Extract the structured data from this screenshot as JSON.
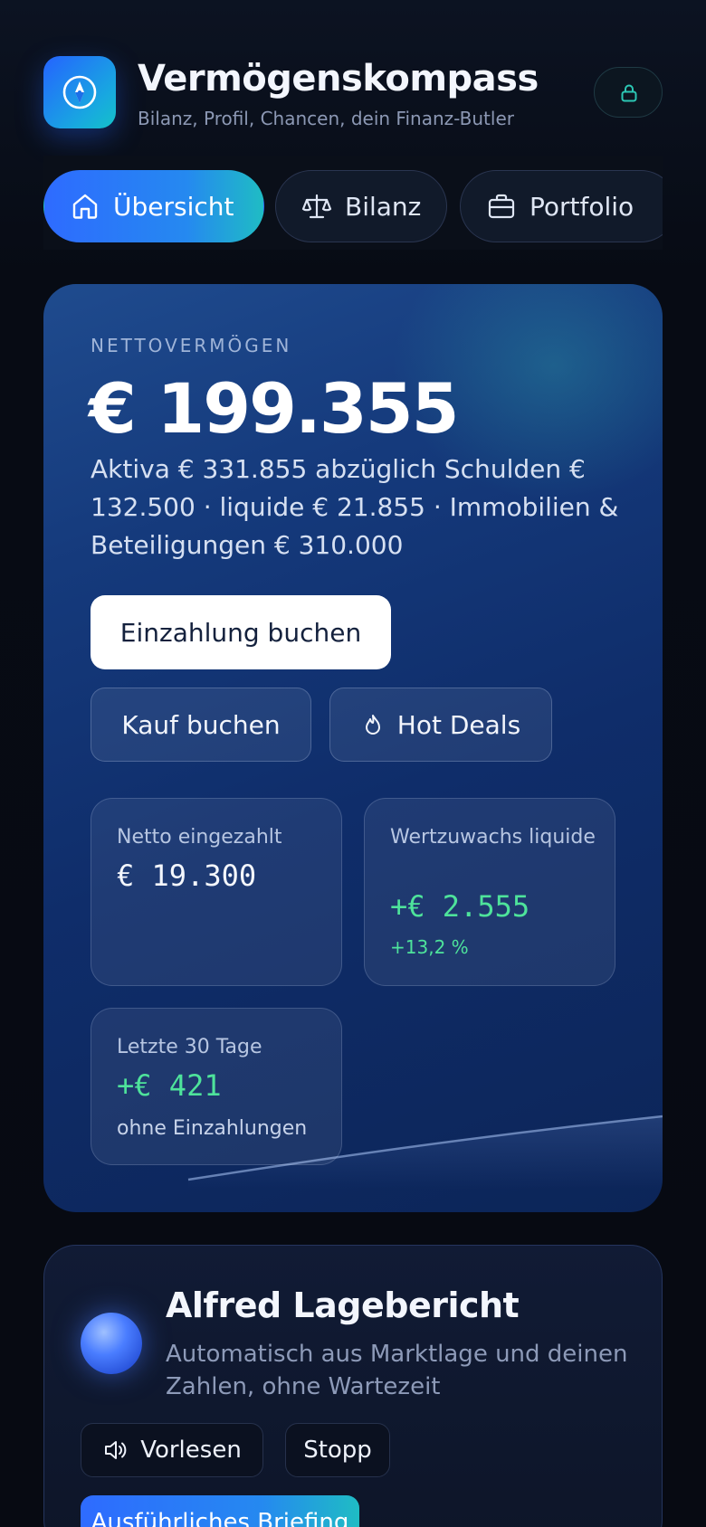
{
  "header": {
    "title": "Vermögenskompass",
    "subtitle": "Bilanz, Profil, Chancen, dein Finanz-Butler",
    "icons": {
      "app": "compass-icon",
      "lock": "lock-icon"
    }
  },
  "tabs": [
    {
      "label": "Übersicht",
      "icon": "home-icon",
      "active": true
    },
    {
      "label": "Bilanz",
      "icon": "scale-icon",
      "active": false
    },
    {
      "label": "Portfolio",
      "icon": "briefcase-icon",
      "active": false
    }
  ],
  "hero": {
    "label": "NETTOVERMÖGEN",
    "value": "€ 199.355",
    "description": "Aktiva € 331.855 abzüglich Schulden € 132.500 · liquide € 21.855 · Immobilien & Beteiligungen € 310.000",
    "primary_button": "Einzahlung buchen",
    "buy_button": "Kauf buchen",
    "deals_button": "Hot Deals",
    "stats": [
      {
        "label": "Netto eingezahlt",
        "value": "€ 19.300",
        "note": ""
      },
      {
        "label": "Wertzuwachs liquide",
        "value": "+€ 2.555",
        "note": "+13,2 %"
      },
      {
        "label": "Letzte 30 Tage",
        "value": "+€ 421",
        "note": "ohne Einzahlungen"
      }
    ]
  },
  "briefing": {
    "title": "Alfred Lagebericht",
    "subtitle": "Automatisch aus Marktlage und deinen Zahlen, ohne Wartezeit",
    "read_button": "Vorlesen",
    "stop_button": "Stopp",
    "cta_button": "Ausführliches Briefing"
  },
  "colors": {
    "accent": "#2e6bff",
    "accent_teal": "#1fbcc4",
    "positive": "#4ee39b",
    "background": "#070a12"
  }
}
